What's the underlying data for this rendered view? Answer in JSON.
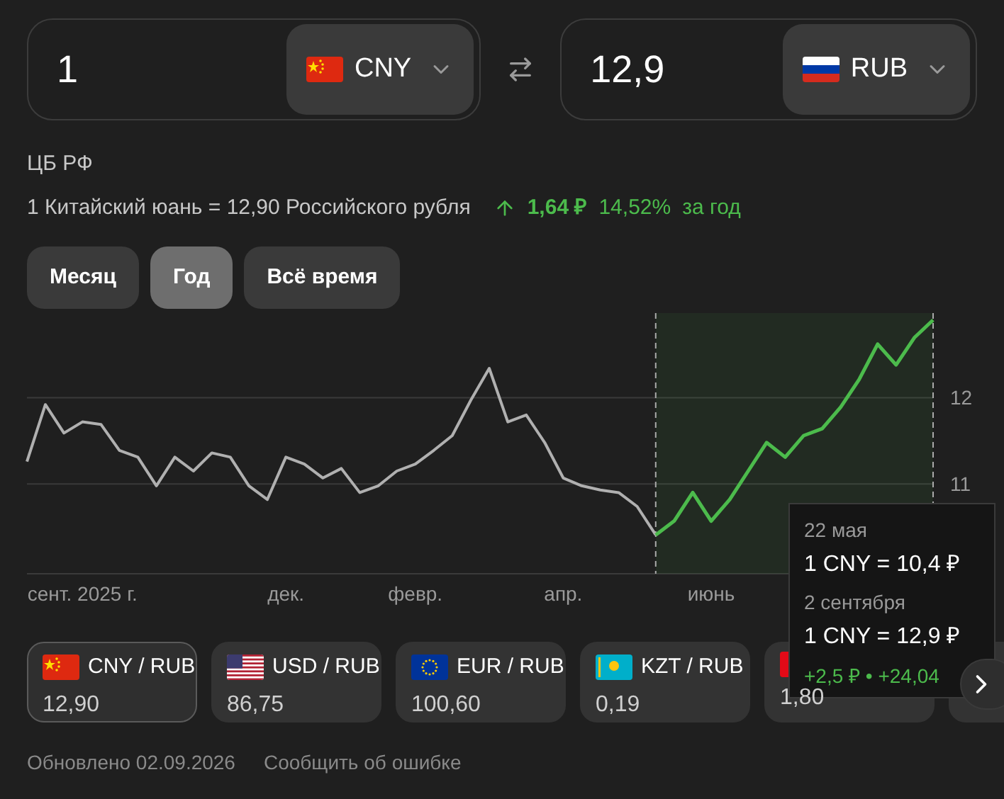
{
  "converter": {
    "from": {
      "amount": "1",
      "currency": "CNY"
    },
    "to": {
      "amount": "12,9",
      "currency": "RUB"
    }
  },
  "source": "ЦБ РФ",
  "rate": {
    "text": "1 Китайский юань = 12,90 Российского рубля",
    "change": "1,64 ₽",
    "percent": "14,52%",
    "period": "за год"
  },
  "periods": [
    {
      "label": "Месяц",
      "selected": false
    },
    {
      "label": "Год",
      "selected": true
    },
    {
      "label": "Всё время",
      "selected": false
    }
  ],
  "chart": {
    "chart_data": {
      "type": "line",
      "ylim": [
        9.96,
        12.98
      ],
      "grid": true,
      "yticks": [
        11,
        12
      ],
      "categories": [
        null,
        null,
        null,
        "сент. 2025 г.",
        null,
        null,
        null,
        null,
        null,
        null,
        null,
        null,
        null,
        null,
        "дек.",
        null,
        null,
        null,
        null,
        null,
        null,
        "февр.",
        null,
        null,
        null,
        null,
        null,
        null,
        null,
        "апр.",
        null,
        null,
        null,
        null,
        null,
        null,
        null,
        "июнь",
        null,
        null,
        null,
        null,
        null,
        null,
        null,
        null,
        null,
        null,
        null,
        null
      ],
      "series": [
        {
          "color": "#b0b0b0",
          "values": [
            11.26,
            11.92,
            11.59,
            11.72,
            11.69,
            11.39,
            11.31,
            10.98,
            11.31,
            11.15,
            11.36,
            11.31,
            10.98,
            10.82,
            11.31,
            11.23,
            11.07,
            11.18,
            10.9,
            10.98,
            11.15,
            11.23,
            11.39,
            11.56,
            11.97,
            12.34,
            11.72,
            11.8,
            11.48,
            11.07,
            10.98,
            10.93,
            10.9,
            10.74,
            10.41,
            null,
            null,
            null,
            null,
            null,
            null,
            null,
            null,
            null,
            null,
            null,
            null,
            null,
            null,
            null
          ]
        },
        {
          "color": "#4cbb4c",
          "values": [
            null,
            null,
            null,
            null,
            null,
            null,
            null,
            null,
            null,
            null,
            null,
            null,
            null,
            null,
            null,
            null,
            null,
            null,
            null,
            null,
            null,
            null,
            null,
            null,
            null,
            null,
            null,
            null,
            null,
            null,
            null,
            null,
            null,
            null,
            10.41,
            10.57,
            10.9,
            10.57,
            10.82,
            11.15,
            11.48,
            11.31,
            11.56,
            11.64,
            11.89,
            12.21,
            12.62,
            12.38,
            12.7,
            12.9
          ]
        }
      ]
    },
    "tooltip": {
      "start_date": "22 мая",
      "start_value": "1 CNY = 10,4 ₽",
      "end_date": "2 сентября",
      "end_value": "1 CNY = 12,9 ₽",
      "change": "+2,5 ₽ • +24,04"
    }
  },
  "pairs": [
    {
      "pair": "CNY / RUB",
      "value": "12,90",
      "selected": true
    },
    {
      "pair": "USD / RUB",
      "value": "86,75",
      "selected": false
    },
    {
      "pair": "EUR / RUB",
      "value": "100,60",
      "selected": false
    },
    {
      "pair": "KZT / RUB",
      "value": "0,19",
      "selected": false
    },
    {
      "value": "1,80",
      "selected": false
    }
  ],
  "footer": {
    "updated": "Обновлено 02.09.2026",
    "report": "Сообщить об ошибке"
  }
}
